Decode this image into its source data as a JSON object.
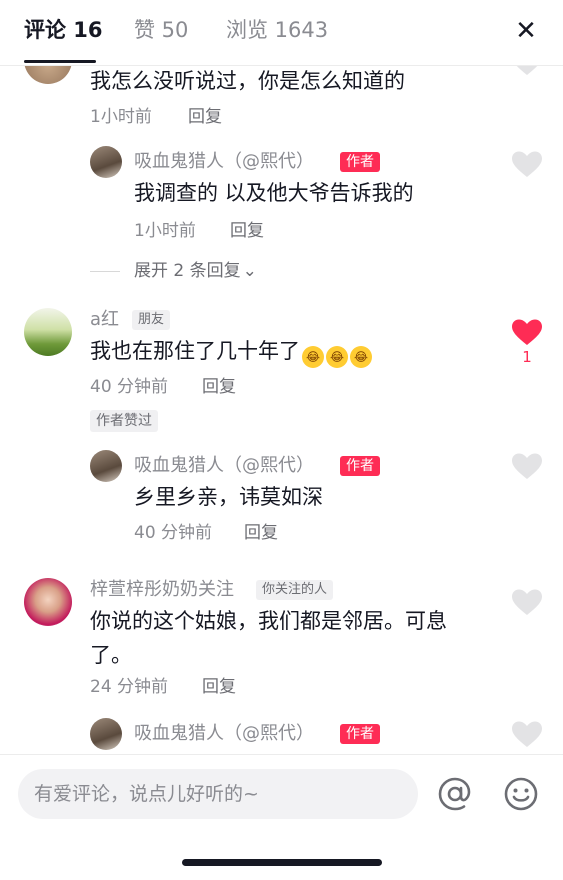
{
  "header": {
    "tabs": [
      {
        "label": "评论 16"
      },
      {
        "label": "赞 50"
      },
      {
        "label": "浏览 1643"
      }
    ],
    "close_icon": "close-icon"
  },
  "comments": [
    {
      "text": "我怎么没听说过，你是怎么知道的",
      "time": "1小时前",
      "reply_label": "回复",
      "replies": [
        {
          "name": "吸血鬼猎人（@熙代）",
          "tag": "作者",
          "text": "我调查的 以及他大爷告诉我的",
          "time": "1小时前",
          "reply_label": "回复"
        }
      ],
      "expand_label": "展开 2 条回复"
    },
    {
      "name": "a红",
      "badge": "朋友",
      "text": "我也在那住了几十年了",
      "emoji_count": 3,
      "time": "40 分钟前",
      "reply_label": "回复",
      "liked": true,
      "like_count": "1",
      "author_liked_label": "作者赞过",
      "replies": [
        {
          "name": "吸血鬼猎人（@熙代）",
          "tag": "作者",
          "text": "乡里乡亲，讳莫如深",
          "time": "40 分钟前",
          "reply_label": "回复"
        }
      ]
    },
    {
      "name": "梓萱梓彤奶奶关注",
      "badge": "你关注的人",
      "text_line1": "你说的这个姑娘，我们都是邻居。可息",
      "text_line2": "了。",
      "time": "24 分钟前",
      "reply_label": "回复",
      "replies": [
        {
          "name": "吸血鬼猎人（@熙代）",
          "tag": "作者"
        }
      ]
    }
  ],
  "input": {
    "placeholder": "有爱评论，说点儿好听的~"
  },
  "colors": {
    "accent": "#fe2c55",
    "text_primary": "#161823",
    "text_secondary": "#8a8b91"
  }
}
